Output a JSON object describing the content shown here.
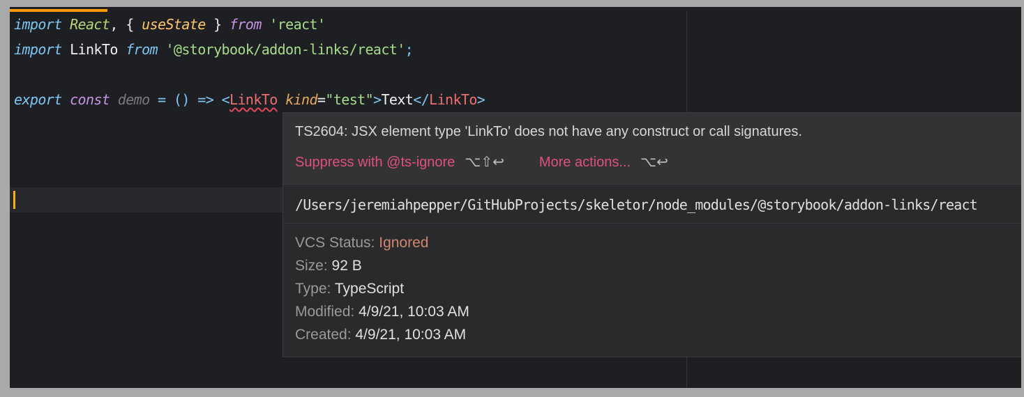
{
  "code": {
    "line1": {
      "kw_import": "import",
      "react": "React",
      "sep1": ",",
      "brace_open": "{",
      "useState": "useState",
      "brace_close": "}",
      "kw_from": "from",
      "str": "'react'"
    },
    "line2": {
      "kw_import": "import",
      "linkto": "LinkTo",
      "kw_from": "from",
      "str": "'@storybook/addon-links/react'",
      "semi": ";"
    },
    "line3": {
      "kw_export": "export",
      "kw_const": "const",
      "name": "demo",
      "eq": "=",
      "parens": "()",
      "arrow": "=>",
      "lt": "<",
      "tag": "LinkTo",
      "attr": "kind",
      "attr_eq": "=",
      "attr_val": "\"test\"",
      "gt": ">",
      "text": "Text",
      "close_open": "</",
      "close_tag": "LinkTo",
      "close_gt": ">"
    }
  },
  "popup": {
    "error_message": "TS2604: JSX element type 'LinkTo' does not have any construct or call signatures.",
    "actions": [
      {
        "label": "Suppress with @ts-ignore",
        "shortcut": "⌥⇧↩"
      },
      {
        "label": "More actions...",
        "shortcut": "⌥↩"
      }
    ],
    "path": "/Users/jeremiahpepper/GitHubProjects/skeletor/node_modules/@storybook/addon-links/react",
    "info": {
      "vcs_label": "VCS Status:",
      "vcs_value": "Ignored",
      "size_label": "Size:",
      "size_value": "92 B",
      "type_label": "Type:",
      "type_value": "TypeScript",
      "modified_label": "Modified:",
      "modified_value": "4/9/21, 10:03 AM",
      "created_label": "Created:",
      "created_value": "4/9/21, 10:03 AM"
    }
  },
  "colors": {
    "editor_bg": "#1e1f22",
    "tab_indicator": "#ff9900",
    "caret": "#f2b40a",
    "error_underline": "#e0485a",
    "action_link": "#e0507a",
    "vcs_ignored": "#d0866e"
  }
}
